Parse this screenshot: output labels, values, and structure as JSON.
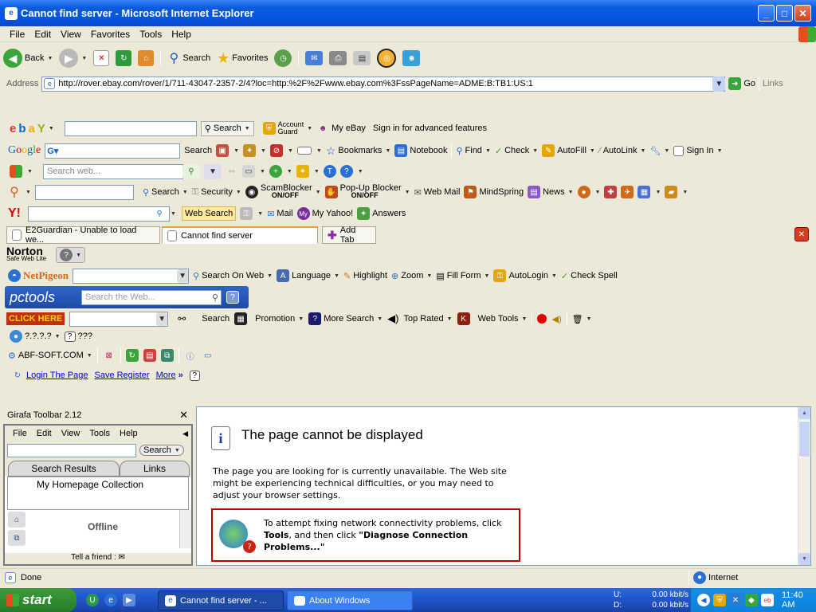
{
  "window": {
    "title": "Cannot find server - Microsoft Internet Explorer"
  },
  "menu": [
    "File",
    "Edit",
    "View",
    "Favorites",
    "Tools",
    "Help"
  ],
  "nav": {
    "back": "Back",
    "search": "Search",
    "favorites": "Favorites"
  },
  "address": {
    "label": "Address",
    "url": "http://rover.ebay.com/rover/1/711-43047-2357-2/4?loc=http:%2F%2Fwww.ebay.com%3FssPageName=ADME:B:TB1:US:1",
    "go": "Go",
    "links": "Links"
  },
  "ebay": {
    "search": "Search",
    "account_guard_1": "Account",
    "account_guard_2": "Guard",
    "my_ebay": "My eBay",
    "signin": "Sign in for advanced features"
  },
  "google": {
    "search": "Search",
    "bookmarks": "Bookmarks",
    "notebook": "Notebook",
    "find": "Find",
    "check": "Check",
    "autofill": "AutoFill",
    "autolink": "AutoLink",
    "signin": "Sign In"
  },
  "msn": {
    "placeholder": "Search web..."
  },
  "earthlink": {
    "search": "Search",
    "security": "Security",
    "scamblocker": "ScamBlocker",
    "on_off": "ON/OFF",
    "popup_blocker": "Pop-Up Blocker",
    "popup_on_off": "ON/OFF",
    "webmail": "Web Mail",
    "mindspring": "MindSpring",
    "news": "News"
  },
  "yahoo": {
    "web_search": "Web Search",
    "mail": "Mail",
    "my_yahoo": "My Yahoo!",
    "answers": "Answers"
  },
  "tabs": [
    "E2Guardian - Unable to load we...",
    "Cannot find server"
  ],
  "add_tab": "Add Tab",
  "norton": {
    "name": "Norton",
    "sub": "Safe Web Lite"
  },
  "netpigeon": {
    "name": "NetPigeon",
    "search_on_web": "Search On Web",
    "language": "Language",
    "highlight": "Highlight",
    "zoom": "Zoom",
    "fill_form": "Fill Form",
    "autologin": "AutoLogin",
    "check_spell": "Check Spell"
  },
  "pctools": {
    "name": "pctools",
    "placeholder": "Search the Web..."
  },
  "clickhere": {
    "label": "CLICK HERE",
    "search": "Search",
    "promotion": "Promotion",
    "more_search": "More Search",
    "top_rated": "Top Rated",
    "web_tools": "Web Tools"
  },
  "unknown": {
    "a": "?.?.?.?",
    "b": "???"
  },
  "abf": {
    "name": "ABF-SOFT.COM"
  },
  "login": {
    "login": "Login The Page",
    "save": "Save Register",
    "more": "More"
  },
  "girafa": {
    "title": "Girafa Toolbar 2.12",
    "menu": [
      "File",
      "Edit",
      "View",
      "Tools",
      "Help"
    ],
    "search": "Search",
    "tab_results": "Search Results",
    "tab_links": "Links",
    "collection": "My Homepage Collection",
    "offline": "Offline",
    "tell": "Tell a friend :"
  },
  "page": {
    "heading": "The page cannot be displayed",
    "body": "The page you are looking for is currently unavailable. The Web site might be experiencing technical difficulties, or you may need to adjust your browser settings.",
    "tip_1": "To attempt fixing network connectivity problems, click",
    "tip_tools": "Tools",
    "tip_2": ", and then click",
    "tip_diag": "\"Diagnose Connection Problems...\""
  },
  "status": {
    "done": "Done",
    "zone": "Internet"
  },
  "taskbar": {
    "start": "start",
    "task1": "Cannot find server - ...",
    "task2": "About Windows",
    "u_label": "U:",
    "d_label": "D:",
    "u": "0.00 kbit/s",
    "d": "0.00 kbit/s",
    "clock": "11:40 AM"
  },
  "colors": {
    "xp_blue": "#0554e0",
    "start_green": "#2f8a2f",
    "tip_border": "#c00000",
    "link": "#0000cc"
  }
}
